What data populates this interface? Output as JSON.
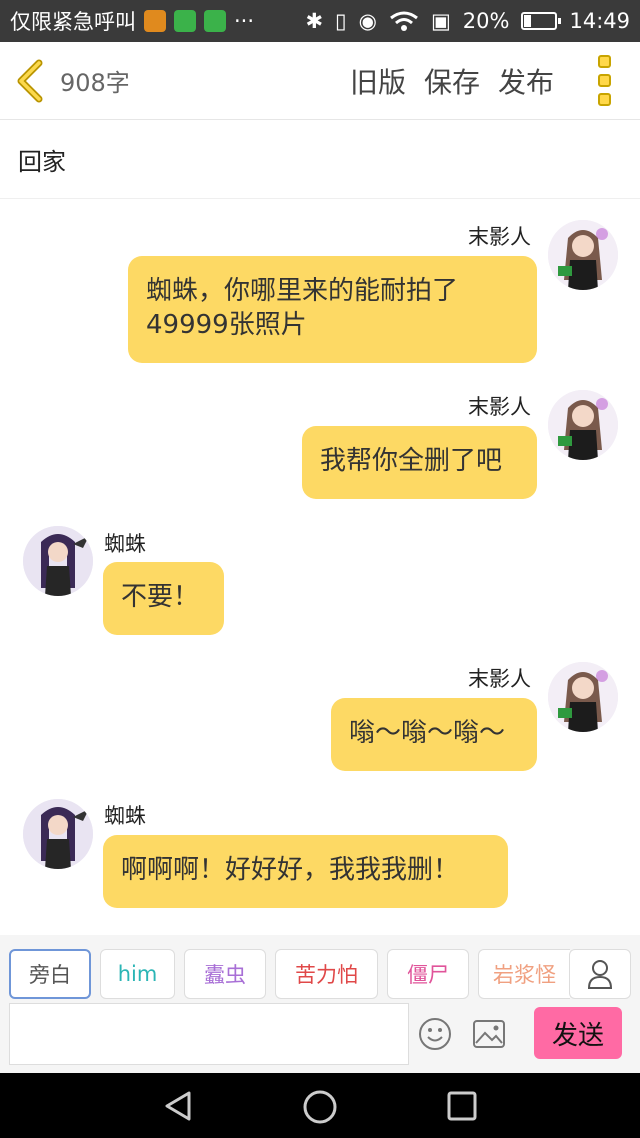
{
  "status_bar": {
    "notification_text": "仅限紧急呼叫",
    "dots": "···",
    "battery_text": "20%",
    "battery_level": 0.2,
    "time": "14:49"
  },
  "header": {
    "word_count": "908字",
    "old_version": "旧版",
    "save": "保存",
    "publish": "发布"
  },
  "title": "回家",
  "messages": [
    {
      "sender": "末影人",
      "side": "right",
      "text": "蜘蛛，你哪里来的能耐拍了49999张照片"
    },
    {
      "sender": "末影人",
      "side": "right",
      "text": "我帮你全删了吧"
    },
    {
      "sender": "蜘蛛",
      "side": "left",
      "text": "不要！"
    },
    {
      "sender": "末影人",
      "side": "right",
      "text": "嗡～嗡～嗡～"
    },
    {
      "sender": "蜘蛛",
      "side": "left",
      "text": "啊啊啊！好好好，我我我删！"
    }
  ],
  "roles": [
    {
      "label": "旁白",
      "color": "#555555"
    },
    {
      "label": "him",
      "color": "#2bb5b5"
    },
    {
      "label": "蠹虫",
      "color": "#a86fd6"
    },
    {
      "label": "苦力怕",
      "color": "#e04848"
    },
    {
      "label": "僵尸",
      "color": "#e0549a"
    },
    {
      "label": "岩浆怪",
      "color": "#f0a080"
    }
  ],
  "input": {
    "placeholder": "",
    "send_label": "发送"
  }
}
